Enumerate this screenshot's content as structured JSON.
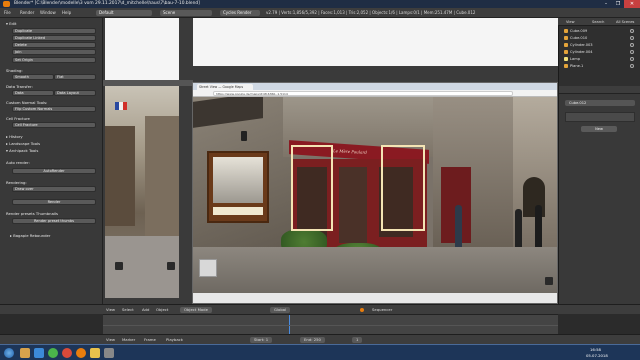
{
  "window": {
    "title": "Blender* [C:\\Blender\\modelle\\3 vom 29.11.2017\\d_mitchelle\\haus\\7\\bau-7-10.blend]",
    "buttons": [
      "–",
      "❐",
      "✕"
    ]
  },
  "info_bar": {
    "menus": [
      "File",
      "Render",
      "Window",
      "Help"
    ],
    "layout": "Default",
    "scene": "Scene",
    "engine": "Cycles Render",
    "stats": "v2.79 | Verts:1,856/5,392 | Faces:1,013 | Tris:2,052 | Objects:1/6 | Lamps:0/1 | Mem:251.47M | Cube.012"
  },
  "tool_panel": {
    "sections": [
      {
        "title": "▾ Edit",
        "buttons": [
          "Duplicate",
          "Duplicate Linked",
          "Delete",
          "Join",
          "Set Origin"
        ]
      },
      {
        "title": "Shading:",
        "buttons": [
          "Smooth",
          "Flat"
        ]
      },
      {
        "title": "Data Transfer:",
        "buttons": [
          "Data",
          "Data Layout"
        ]
      },
      {
        "title": "Custom Normal Tools:",
        "buttons": [
          "Flip Custom Normals"
        ]
      },
      {
        "title": "Cell Fracture",
        "buttons": [
          "Cell Fracture"
        ]
      },
      {
        "title": "▸ History",
        "buttons": []
      },
      {
        "title": "▸ Landscape Tools",
        "buttons": []
      },
      {
        "title": "▾ Archipack Tools",
        "buttons": []
      },
      {
        "title": "Auto render:",
        "buttons": [
          "AutoRender"
        ]
      },
      {
        "title": "Rendering:",
        "buttons": [
          "Draw over",
          "Render"
        ]
      },
      {
        "title": "Render presets Thumbnails",
        "buttons": [
          "Render preset thumbs"
        ]
      },
      {
        "title": "▸ Bagapie Rebounder",
        "buttons": []
      }
    ]
  },
  "outliner": {
    "header": [
      "View",
      "Search",
      "All Scenes"
    ],
    "items": [
      "Cube.009",
      "Cube.010",
      "Cylinder.003",
      "Cylinder.004",
      "Lamp",
      "Plane.1"
    ]
  },
  "properties": {
    "object_name": "Cube.012",
    "button": "New"
  },
  "viewport": {
    "mode": "Object Mode",
    "global": "Global",
    "menus": [
      "View",
      "Select",
      "Add",
      "Object"
    ]
  },
  "browser": {
    "tab_label": "Street View — Google Maps",
    "url": "https://www.google.de/maps/@48.6360,-1.5114"
  },
  "street_sign": "Le Mère Poulard",
  "timeline": {
    "menus": [
      "View",
      "Marker",
      "Frame",
      "Playback"
    ],
    "start_label": "Start: 1",
    "end_label": "End: 250",
    "current_frame": "1",
    "sequence": "Sequencer"
  },
  "taskbar": {
    "time": "16:58",
    "date": "05.07.2018"
  },
  "colors": {
    "blender_bg": "#393939",
    "accent": "#e87d0d",
    "selection_frame": "#f4e4b4",
    "taskbar": "#1d3558"
  }
}
